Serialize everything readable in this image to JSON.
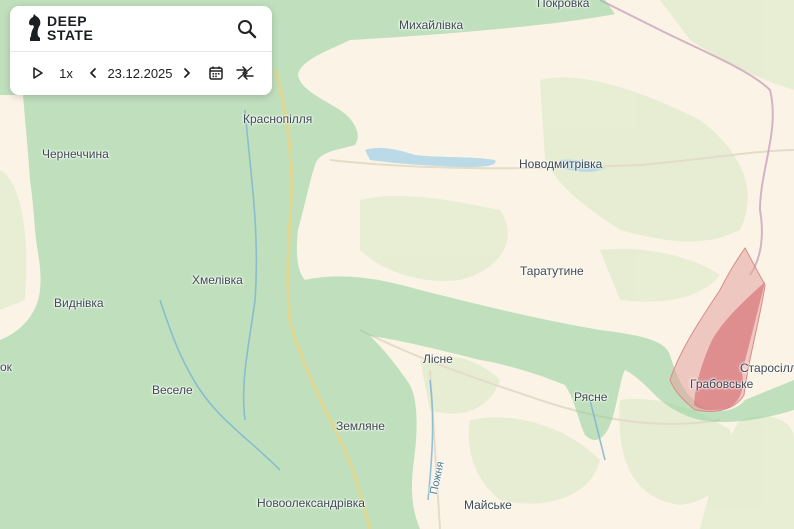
{
  "app": {
    "brand_line1": "DEEP",
    "brand_line2": "STATE"
  },
  "controls": {
    "speed": "1x",
    "date": "23.12.2025"
  },
  "places": {
    "pokrovka": "Покровка",
    "mykhailivka": "Михайлівка",
    "krasnopillia": "Краснопілля",
    "chernechchyna": "Чернеччина",
    "novodmytrivka": "Новодмитрівка",
    "taratutyne": "Таратутине",
    "khmelivka": "Хмелівка",
    "vydnivka": "Виднівка",
    "ok": "ок",
    "vesele": "Веселе",
    "lisne": "Лісне",
    "riasne": "Рясне",
    "starosillia": "Старосілля",
    "hrabovske": "Грабовське",
    "zemliane": "Земляне",
    "pozhnia": "Пожня",
    "novooleksandrivka": "Новоолександрівка",
    "maiske": "Майське"
  },
  "colors": {
    "land": "#fbf4e6",
    "forest": "#e3ebcf",
    "controlled_zone": "#8fcf9b",
    "contested_zone": "#e6a3a3",
    "occupied_core": "#d9767a",
    "water": "#a9d3e6",
    "border": "#c9a2bd"
  },
  "icons": {
    "logo": "chess-knight-icon",
    "search": "search-icon",
    "play": "play-icon",
    "prev": "chevron-left-icon",
    "next": "chevron-right-icon",
    "calendar": "calendar-icon",
    "compare": "compare-arrows-icon"
  }
}
